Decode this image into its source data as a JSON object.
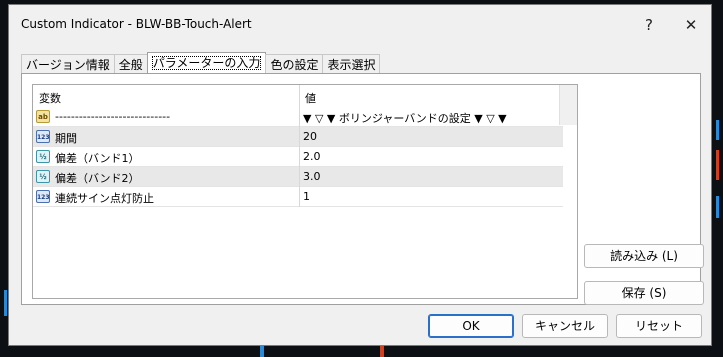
{
  "window": {
    "title": "Custom Indicator - BLW-BB-Touch-Alert",
    "help_glyph": "?",
    "close_glyph": "✕"
  },
  "tabs": [
    {
      "label": "バージョン情報",
      "active": false
    },
    {
      "label": "全般",
      "active": false
    },
    {
      "label": "パラメーターの入力",
      "active": true
    },
    {
      "label": "色の設定",
      "active": false
    },
    {
      "label": "表示選択",
      "active": false
    }
  ],
  "grid": {
    "headers": {
      "name": "変数",
      "value": "値"
    },
    "rows": [
      {
        "icon": "ab",
        "icon_name": "string-type-icon",
        "name": "-----------------------------",
        "value": "▼ ▽ ▼ ボリンジャーバンドの設定 ▼ ▽ ▼",
        "shaded": false
      },
      {
        "icon": "123",
        "icon_name": "integer-type-icon",
        "name": "期間",
        "value": "20",
        "shaded": true
      },
      {
        "icon": "½",
        "icon_name": "double-type-icon",
        "name": "偏差（バンド1）",
        "value": "2.0",
        "shaded": false
      },
      {
        "icon": "½",
        "icon_name": "double-type-icon",
        "name": "偏差（バンド2）",
        "value": "3.0",
        "shaded": true
      },
      {
        "icon": "123",
        "icon_name": "integer-type-icon",
        "name": "連続サイン点灯防止",
        "value": "1",
        "shaded": false
      }
    ]
  },
  "side_buttons": {
    "load": "読み込み (L)",
    "save": "保存 (S)"
  },
  "footer_buttons": {
    "ok": "OK",
    "cancel": "キャンセル",
    "reset": "リセット"
  },
  "colors": {
    "dialog_bg": "#f0f0f0",
    "panel_bg": "#ffffff",
    "shaded_row": "#e8e8e8",
    "ok_border": "#2a6fc9"
  }
}
